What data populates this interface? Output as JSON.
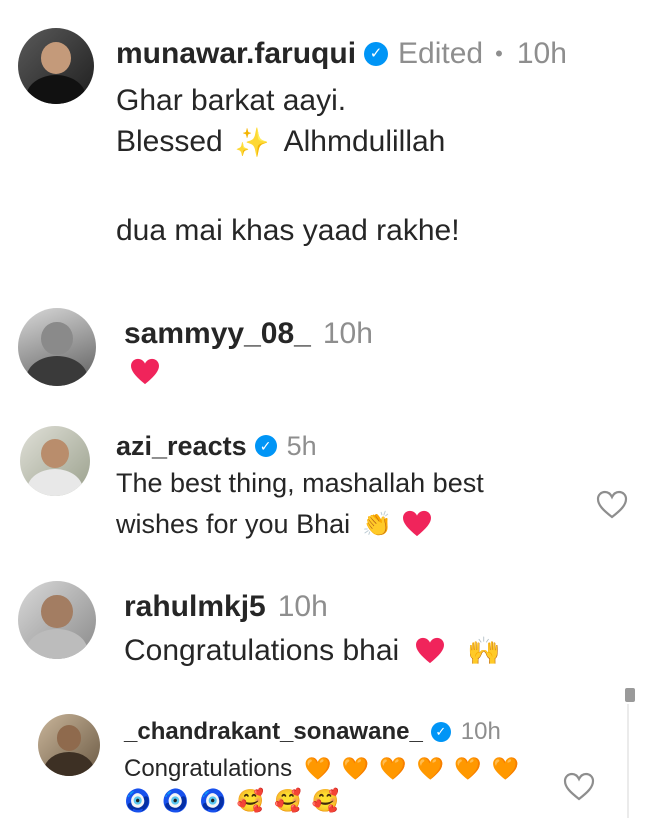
{
  "comments": [
    {
      "username": "munawar.faruqui",
      "verified": true,
      "edited_label": "Edited",
      "separator": "•",
      "time": "10h",
      "lines": [
        "Ghar barkat aayi.",
        "Blessed",
        "Alhmdulillah",
        "dua mai khas yaad rakhe!"
      ],
      "sparkle": "✨"
    },
    {
      "username": "sammyy_08_",
      "verified": false,
      "time": "10h",
      "heart": "❤"
    },
    {
      "username": "azi_reacts",
      "verified": true,
      "time": "5h",
      "lines": [
        "The best thing, mashallah best",
        "wishes for you Bhai"
      ],
      "clap": "👏",
      "heart": "❤",
      "like_icon": "heart-outline-icon"
    },
    {
      "username": "rahulmkj5",
      "verified": false,
      "time": "10h",
      "text": "Congratulations bhai",
      "heart": "❤",
      "raised_hands": "🙌"
    },
    {
      "username": "_chandrakant_sonawane_",
      "verified": true,
      "time": "10h",
      "text": "Congratulations",
      "orange_hearts": "🧡 🧡 🧡 🧡 🧡 🧡",
      "second_line_emojis": "🧿 🧿 🧿 🥰 🥰 🥰",
      "like_icon": "heart-outline-icon"
    }
  ],
  "verified_glyph": "✓",
  "colors": {
    "text": "#262626",
    "muted": "#8e8e8e",
    "verified": "#0095f6",
    "red_heart": "#f0245b"
  }
}
